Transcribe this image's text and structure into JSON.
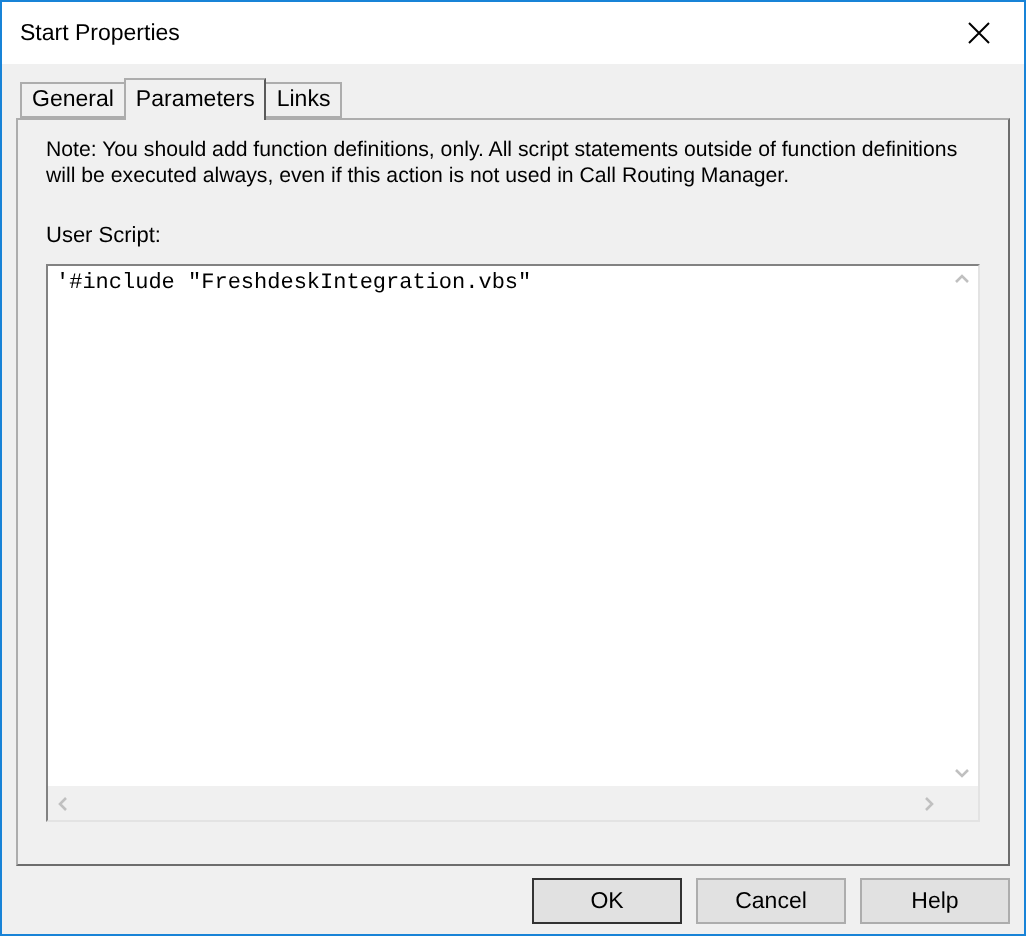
{
  "window": {
    "title": "Start Properties"
  },
  "tabs": [
    {
      "label": "General",
      "selected": false
    },
    {
      "label": "Parameters",
      "selected": true
    },
    {
      "label": "Links",
      "selected": false
    }
  ],
  "note": "Note: You should add function definitions, only. All script statements outside of function definitions will be executed always, even if this action is not used in Call Routing Manager.",
  "script_label": "User Script:",
  "script_value": "'#include \"FreshdeskIntegration.vbs\"",
  "buttons": [
    {
      "label": "OK",
      "default": true
    },
    {
      "label": "Cancel",
      "default": false
    },
    {
      "label": "Help",
      "default": false
    }
  ]
}
